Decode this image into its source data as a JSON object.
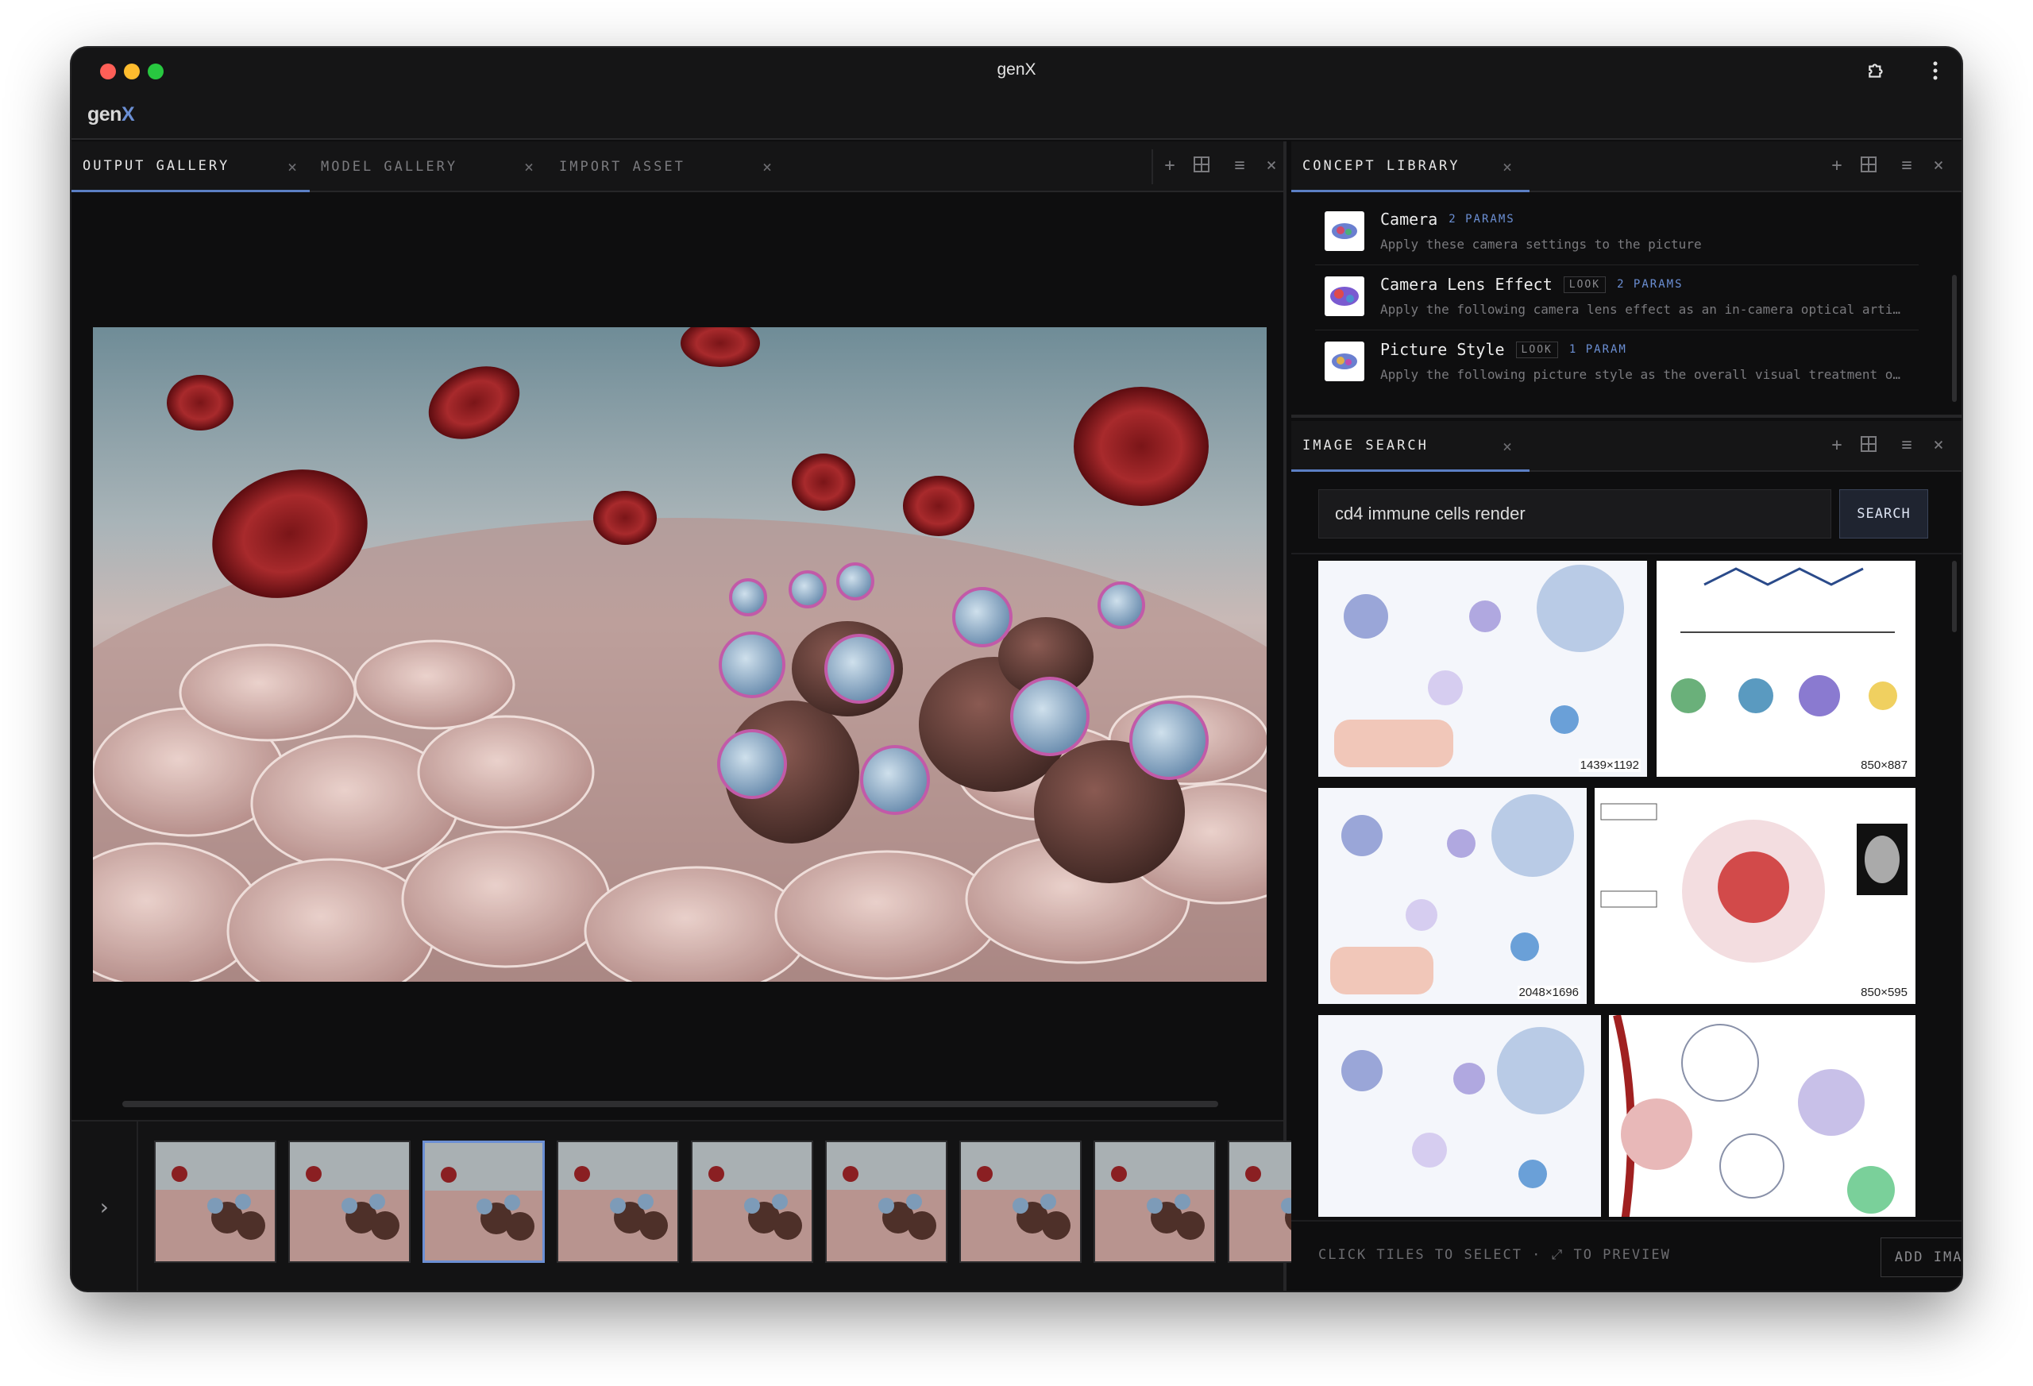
{
  "window": {
    "title": "genX"
  },
  "app": {
    "logo_prefix": "gen",
    "logo_suffix": "X"
  },
  "left_panel": {
    "tabs": [
      {
        "label": "OUTPUT GALLERY",
        "active": true
      },
      {
        "label": "MODEL GALLERY",
        "active": false
      },
      {
        "label": "IMPORT ASSET",
        "active": false
      }
    ],
    "thumbnails_count_visible": 9,
    "selected_thumbnail": 3
  },
  "concept_library": {
    "tab_label": "CONCEPT LIBRARY",
    "items": [
      {
        "name": "Camera",
        "badge": "",
        "params": "2 PARAMS",
        "description": "Apply these camera settings to the picture"
      },
      {
        "name": "Camera Lens Effect",
        "badge": "LOOK",
        "params": "2 PARAMS",
        "description": "Apply the following camera lens effect as an in-camera optical arti…"
      },
      {
        "name": "Picture Style",
        "badge": "LOOK",
        "params": "1 PARAM",
        "description": "Apply the following picture style as the overall visual treatment o…"
      }
    ]
  },
  "image_search": {
    "tab_label": "IMAGE SEARCH",
    "query": "cd4 immune cells render",
    "search_button": "SEARCH",
    "results": [
      {
        "dims": "1439×1192"
      },
      {
        "dims": "850×887"
      },
      {
        "dims": "2048×1696"
      },
      {
        "dims": "850×595"
      },
      {
        "dims": ""
      },
      {
        "dims": ""
      }
    ],
    "footer_hint": "CLICK TILES TO SELECT · ⤢ TO PREVIEW",
    "add_button": "ADD IMAGES"
  },
  "colors": {
    "accent": "#5b7fc4",
    "background": "#0e0e0f",
    "panel_header": "#151516"
  },
  "icons": [
    "extension-icon",
    "more-vertical-icon",
    "plus-icon",
    "layout-grid-icon",
    "menu-icon",
    "close-icon",
    "chevron-right-icon"
  ]
}
